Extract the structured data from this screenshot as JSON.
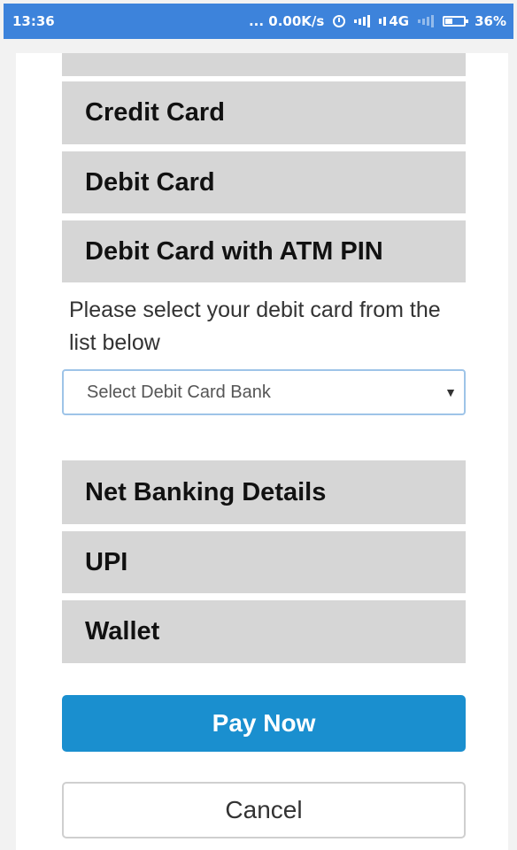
{
  "status_bar": {
    "time": "13:36",
    "net_speed": "... 0.00K/s",
    "network": "4G",
    "battery": "36%",
    "icons": [
      "alarm-icon",
      "signal-icon",
      "signal-4g-icon",
      "signal-weak-icon",
      "battery-icon"
    ]
  },
  "payment_options": {
    "items": [
      {
        "label": ""
      },
      {
        "label": "Credit Card"
      },
      {
        "label": "Debit Card"
      },
      {
        "label": "Debit Card with ATM PIN"
      }
    ],
    "expanded": {
      "instruction": "Please select your debit card from the list below",
      "select": {
        "selected": "Select Debit Card Bank",
        "icon": "caret-down-icon"
      }
    },
    "more_items": [
      {
        "label": "Net Banking Details"
      },
      {
        "label": "UPI"
      },
      {
        "label": "Wallet"
      }
    ]
  },
  "actions": {
    "pay_label": "Pay Now",
    "cancel_label": "Cancel"
  },
  "colors": {
    "status_bar": "#3d83db",
    "accordion": "#d6d6d6",
    "pay_button": "#1a8fcf"
  }
}
